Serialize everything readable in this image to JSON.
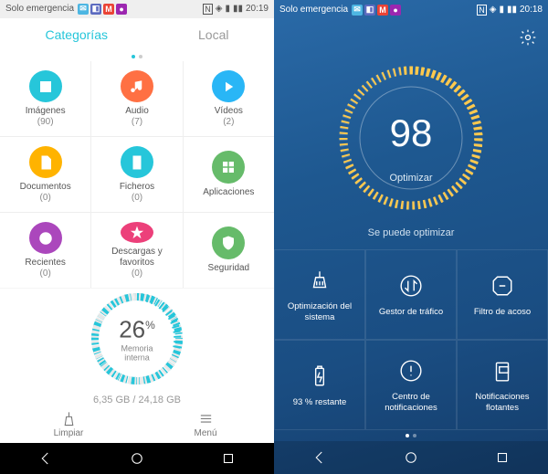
{
  "left": {
    "status": {
      "carrier": "Solo emergencia",
      "time": "20:19"
    },
    "tabs": {
      "categories": "Categorías",
      "local": "Local"
    },
    "grid": [
      {
        "label": "Imágenes",
        "count": "(90)",
        "color": "#26c6da"
      },
      {
        "label": "Audio",
        "count": "(7)",
        "color": "#ff7043"
      },
      {
        "label": "Vídeos",
        "count": "(2)",
        "color": "#29b6f6"
      },
      {
        "label": "Documentos",
        "count": "(0)",
        "color": "#ffb300"
      },
      {
        "label": "Ficheros",
        "count": "(0)",
        "color": "#26c6da"
      },
      {
        "label": "Aplicaciones",
        "count": "",
        "color": "#66bb6a"
      },
      {
        "label": "Recientes",
        "count": "(0)",
        "color": "#ab47bc"
      },
      {
        "label": "Descargas y favoritos",
        "count": "(0)",
        "color": "#ec407a"
      },
      {
        "label": "Seguridad",
        "count": "",
        "color": "#66bb6a"
      }
    ],
    "memory": {
      "pct": "26",
      "unit": "%",
      "label": "Memoria interna",
      "size": "6,35 GB / 24,18 GB"
    },
    "bottom": {
      "clean": "Limpiar",
      "menu": "Menú"
    }
  },
  "right": {
    "status": {
      "carrier": "Solo emergencia",
      "time": "20:18"
    },
    "score": {
      "value": "98",
      "label": "Optimizar",
      "msg": "Se puede optimizar"
    },
    "tiles": [
      {
        "label": "Optimización del sistema"
      },
      {
        "label": "Gestor de tráfico"
      },
      {
        "label": "Filtro de acoso"
      },
      {
        "label": "93 % restante"
      },
      {
        "label": "Centro de notificaciones"
      },
      {
        "label": "Notificaciones flotantes"
      }
    ]
  },
  "chart_data": [
    {
      "type": "gauge",
      "title": "Memoria interna",
      "value": 26,
      "max": 100,
      "unit": "%",
      "detail": "6,35 GB / 24,18 GB"
    },
    {
      "type": "gauge",
      "title": "Optimizar",
      "value": 98,
      "max": 100
    }
  ]
}
